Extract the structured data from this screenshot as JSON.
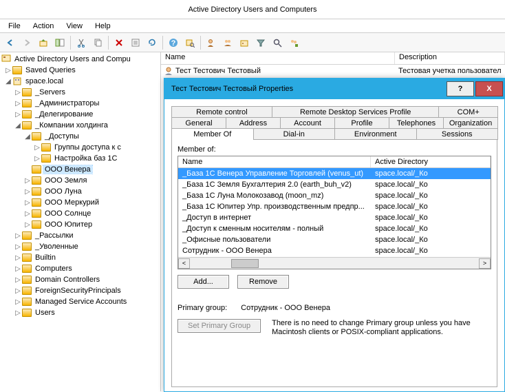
{
  "window_title": "Active Directory Users and Computers",
  "menu": {
    "file": "File",
    "action": "Action",
    "view": "View",
    "help": "Help"
  },
  "tree": {
    "root": "Active Directory Users and Compu",
    "saved_queries": "Saved Queries",
    "domain": "space.local",
    "servers": "_Servers",
    "admins": "_Администраторы",
    "deleg": "_Делегирование",
    "holding": "_Компании холдинга",
    "access": "_Доступы",
    "grp": "Группы доступа к с",
    "cfg1c": "Настройка баз 1С",
    "venera": "ООО Венера",
    "zemlya": "ООО Земля",
    "luna": "ООО Луна",
    "merk": "ООО Меркурий",
    "solnce": "ООО Солнце",
    "jupiter": "ООО Юпитер",
    "mail": "_Рассылки",
    "fired": "_Уволенные",
    "builtin": "Builtin",
    "computers": "Computers",
    "dc": "Domain Controllers",
    "fsp": "ForeignSecurityPrincipals",
    "msa": "Managed Service Accounts",
    "users": "Users"
  },
  "list": {
    "col_name": "Name",
    "col_desc": "Description",
    "row_name": "Тест Тестович Тестовый",
    "row_desc": "Тестовая учетка пользовател"
  },
  "dialog": {
    "title": "Тест Тестович Тестовый Properties",
    "help": "?",
    "close": "X",
    "tabs": {
      "remote_control": "Remote control",
      "rdsp": "Remote Desktop Services Profile",
      "com": "COM+",
      "general": "General",
      "address": "Address",
      "account": "Account",
      "profile": "Profile",
      "telephones": "Telephones",
      "organization": "Organization",
      "member_of": "Member Of",
      "dial_in": "Dial-in",
      "environment": "Environment",
      "sessions": "Sessions"
    },
    "member_of_label": "Member of:",
    "lb_name": "Name",
    "lb_adds": "Active Directory",
    "rows": [
      {
        "n": "_База 1С Венера Управление Торговлей (venus_ut)",
        "d": "space.local/_Ко"
      },
      {
        "n": "_База 1С Земля Бухгалтерия 2.0 (earth_buh_v2)",
        "d": "space.local/_Ко"
      },
      {
        "n": "_База 1С Луна Молокозавод (moon_mz)",
        "d": "space.local/_Ко"
      },
      {
        "n": "_База 1С Юпитер Упр. производственным предпр...",
        "d": "space.local/_Ко"
      },
      {
        "n": "_Доступ в интернет",
        "d": "space.local/_Ко"
      },
      {
        "n": "_Доступ к сменным носителям - полный",
        "d": "space.local/_Ко"
      },
      {
        "n": "_Офисные пользователи",
        "d": "space.local/_Ко"
      },
      {
        "n": "Сотрудник - ООО Венера",
        "d": "space.local/_Ко"
      }
    ],
    "add": "Add...",
    "remove": "Remove",
    "primary_group_label": "Primary group:",
    "primary_group_value": "Сотрудник - ООО Венера",
    "set_primary": "Set Primary Group",
    "primary_note": "There is no need to change Primary group unless you have Macintosh clients or POSIX-compliant applications."
  }
}
